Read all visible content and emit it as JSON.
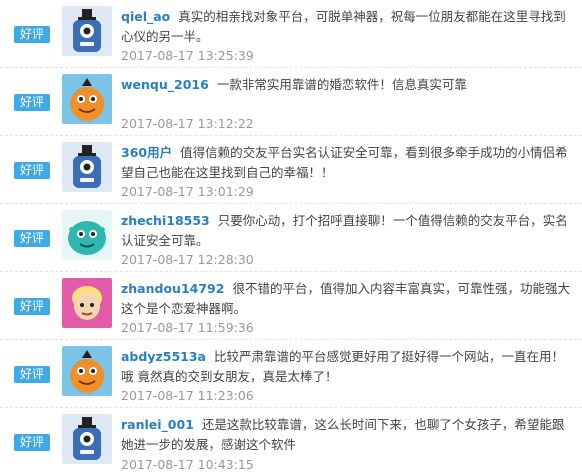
{
  "badge_label": "好评",
  "reviews": [
    {
      "user": "qiel_ao",
      "text": "真实的相亲找对象平台，可脱单神器，祝每一位朋友都能在这里寻找到心仪的另一半。",
      "time": "2017-08-17 13:25:39",
      "avatar": "blue-robot-icon",
      "avatar_color": "#3b6fb5"
    },
    {
      "user": "wenqu_2016",
      "text": "一款非常实用靠谱的婚恋软件！信息真实可靠",
      "time": "2017-08-17 13:12:22",
      "avatar": "orange-monster-icon",
      "avatar_color": "#f0902a"
    },
    {
      "user": "360用户",
      "text": "值得信赖的交友平台实名认证安全可靠，看到很多牵手成功的小情侣希望自己也能在这里找到自己的幸福！！",
      "time": "2017-08-17 13:01:29",
      "avatar": "blue-robot-icon",
      "avatar_color": "#3b6fb5"
    },
    {
      "user": "zhechi18553",
      "text": "只要你心动，打个招呼直接聊！一个值得信赖的交友平台，实名认证安全可靠。",
      "time": "2017-08-17 12:28:30",
      "avatar": "teal-monster-icon",
      "avatar_color": "#2fb7b0"
    },
    {
      "user": "zhandou14792",
      "text": "很不错的平台，值得加入内容丰富真实，可靠性强，功能强大这个是个恋爱神器啊。",
      "time": "2017-08-17 11:59:36",
      "avatar": "pink-girl-icon",
      "avatar_color": "#e25aa8"
    },
    {
      "user": "abdyz5513a",
      "text": "比较严肃靠谱的平台感觉更好用了挺好得一个网站，一直在用！哦 竟然真的交到女朋友，真是太棒了！",
      "time": "2017-08-17 11:23:06",
      "avatar": "orange-monster-icon",
      "avatar_color": "#f0902a"
    },
    {
      "user": "ranlei_001",
      "text": "还是这款比较靠谱，这么长时间下来，也聊了个女孩子，希望能跟她进一步的发展，感谢这个软件",
      "time": "2017-08-17 10:43:15",
      "avatar": "blue-robot-icon",
      "avatar_color": "#3b6fb5"
    }
  ]
}
